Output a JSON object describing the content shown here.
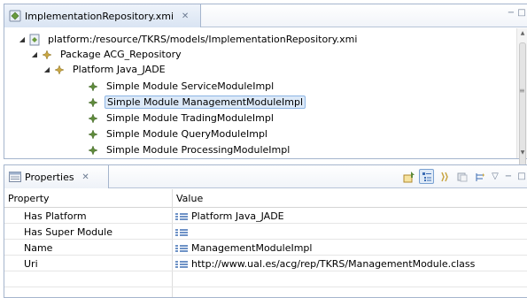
{
  "editor": {
    "tab_title": "ImplementationRepository.xmi",
    "close_glyph": "✕",
    "minimize_glyph": "−",
    "maximize_glyph": "□",
    "tree": [
      {
        "label": "platform:/resource/TKRS/models/ImplementationRepository.xmi",
        "twisty": "◢",
        "icon": "resource-file-icon"
      },
      {
        "label": "Package ACG_Repository",
        "twisty": "◢",
        "icon": "package-node-icon"
      },
      {
        "label": "Platform Java_JADE",
        "twisty": "◢",
        "icon": "platform-node-icon"
      },
      {
        "label": "Simple Module ServiceModuleImpl",
        "icon": "simple-module-icon"
      },
      {
        "label": "Simple Module ManagementModuleImpl",
        "icon": "simple-module-icon",
        "selected": true
      },
      {
        "label": "Simple Module TradingModuleImpl",
        "icon": "simple-module-icon"
      },
      {
        "label": "Simple Module QueryModuleImpl",
        "icon": "simple-module-icon"
      },
      {
        "label": "Simple Module ProcessingModuleImpl",
        "icon": "simple-module-icon"
      }
    ]
  },
  "properties": {
    "tab_title": "Properties",
    "close_glyph": "✕",
    "minimize_glyph": "−",
    "maximize_glyph": "□",
    "menu_glyph": "▽",
    "columns": {
      "property": "Property",
      "value": "Value"
    },
    "rows": [
      {
        "name": "Has Platform",
        "value": "Platform Java_JADE"
      },
      {
        "name": "Has Super Module",
        "value": ""
      },
      {
        "name": "Name",
        "value": "ManagementModuleImpl"
      },
      {
        "name": "Uri",
        "value": "http://www.ual.es/acg/rep/TKRS/ManagementModule.class"
      }
    ]
  },
  "colors": {
    "tab_border": "#a5b5cd",
    "selection_bg": "#dce9f8",
    "selection_border": "#8db5e4",
    "module_icon_green": "#5e8a3a",
    "module_icon_gold": "#c8a542"
  }
}
